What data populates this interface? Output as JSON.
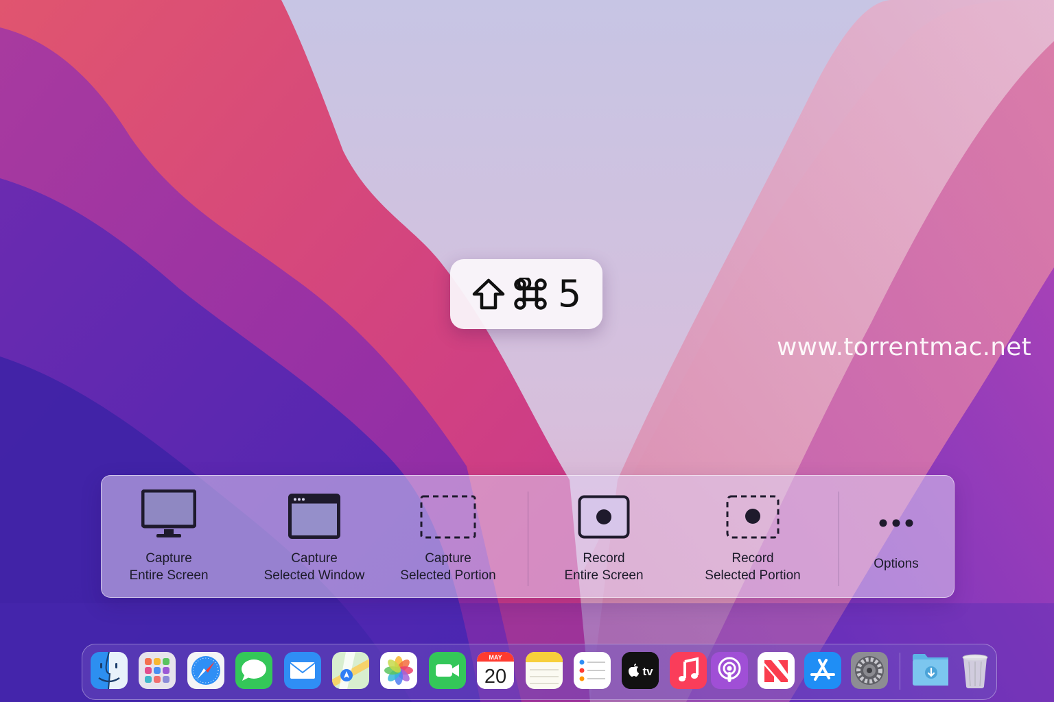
{
  "shortcut": {
    "keys": [
      "shift-key-icon",
      "command-key-icon"
    ],
    "digit": "5"
  },
  "watermark": "www.torrentmac.net",
  "toolbar": {
    "items": [
      {
        "line1": "Capture",
        "line2": "Entire Screen",
        "icon": "monitor-icon"
      },
      {
        "line1": "Capture",
        "line2": "Selected Window",
        "icon": "window-icon"
      },
      {
        "line1": "Capture",
        "line2": "Selected Portion",
        "icon": "dashed-selection-icon"
      },
      {
        "line1": "Record",
        "line2": "Entire Screen",
        "icon": "record-screen-icon"
      },
      {
        "line1": "Record",
        "line2": "Selected Portion",
        "icon": "record-portion-icon"
      },
      {
        "label": "Options",
        "icon": "ellipsis-icon"
      }
    ]
  },
  "dock": {
    "apps": [
      {
        "icon": "finder-icon"
      },
      {
        "icon": "launchpad-icon"
      },
      {
        "icon": "safari-icon"
      },
      {
        "icon": "messages-icon"
      },
      {
        "icon": "mail-icon"
      },
      {
        "icon": "maps-icon"
      },
      {
        "icon": "photos-icon"
      },
      {
        "icon": "facetime-icon"
      },
      {
        "icon": "calendar-icon",
        "month": "MAY",
        "day": "20"
      },
      {
        "icon": "notes-icon"
      },
      {
        "icon": "reminders-icon"
      },
      {
        "icon": "apple-tv-icon",
        "label": "tv"
      },
      {
        "icon": "music-icon"
      },
      {
        "icon": "podcasts-icon"
      },
      {
        "icon": "news-icon"
      },
      {
        "icon": "app-store-icon"
      },
      {
        "icon": "system-preferences-icon"
      },
      {
        "icon": "downloads-folder-icon"
      },
      {
        "icon": "trash-icon"
      }
    ]
  },
  "colors": {
    "wallpaper_pink": "#d24a78",
    "wallpaper_purple": "#5b2fb2",
    "wallpaper_light": "#c9c3e6",
    "toolbar_text": "#1c1b2a",
    "icon_stroke": "#1e1a2c"
  }
}
